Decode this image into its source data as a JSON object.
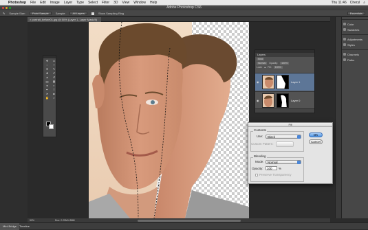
{
  "menubar": {
    "app": "Photoshop",
    "menus": [
      "File",
      "Edit",
      "Image",
      "Layer",
      "Type",
      "Select",
      "Filter",
      "3D",
      "View",
      "Window",
      "Help"
    ],
    "clock": "Thu 11:46",
    "user": "Cheryl"
  },
  "app_title": "Adobe Photoshop CS6",
  "options": {
    "sample_size_label": "Sample Size:",
    "sample_size_value": "Point Sample",
    "sample_label": "Sample:",
    "sample_value": "All Layers",
    "show_ring": "Show Sampling Ring",
    "workspace": "Essentials"
  },
  "document_tab": "portrait_before01.jpg @ 50% (Layer 1, Layer Mask/8)",
  "dock": {
    "items": [
      "Color",
      "Swatches",
      "Adjustments",
      "Styles",
      "Channels",
      "Paths"
    ]
  },
  "layers_panel": {
    "tab": "Layers",
    "kind": "Kind",
    "blend": "Normal",
    "opacity_label": "Opacity:",
    "opacity": "100%",
    "lock_label": "Lock:",
    "fill_label": "Fill:",
    "fill": "100%",
    "layers": [
      {
        "name": "Layer 1",
        "selected": true
      },
      {
        "name": "Layer 0",
        "selected": false
      }
    ]
  },
  "fill_dialog": {
    "title": "Fill",
    "contents_label": "Contents",
    "use_label": "Use:",
    "use_value": "Black",
    "custom_pattern_label": "Custom Pattern:",
    "blending_label": "Blending",
    "mode_label": "Mode:",
    "mode_value": "Normal",
    "opacity_label": "Opacity:",
    "opacity_value": "100",
    "opacity_unit": "%",
    "preserve_label": "Preserve Transparency",
    "ok_label": "OK",
    "cancel_label": "Cancel"
  },
  "status": {
    "zoom": "50%",
    "doc": "Doc: 2.29M/4.58M"
  },
  "mini_bridge": {
    "tab1": "Mini Bridge",
    "tab2": "Timeline"
  }
}
